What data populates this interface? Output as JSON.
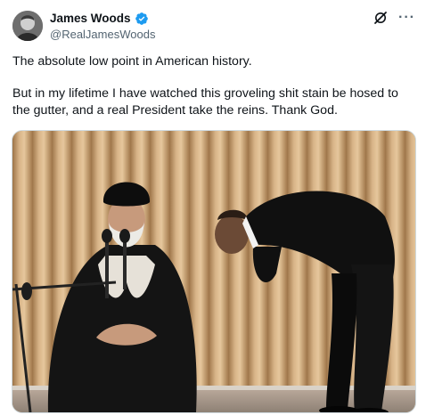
{
  "author": {
    "display_name": "James Woods",
    "handle": "@RealJamesWoods",
    "verified": true,
    "verified_color": "#1d9bf0"
  },
  "header": {
    "grok_icon": "grok-slash-icon",
    "more_icon": "more-icon",
    "more_label": "···"
  },
  "tweet": {
    "paragraphs": [
      "The absolute low point in American history.",
      "But in my lifetime I have watched this groveling shit stain be hosed to the gutter, and a real President take the reins. Thank God."
    ]
  },
  "media": {
    "type": "photo",
    "scene": "two men in front of a beige pleated curtain, one seated with a microphone, one bowing"
  }
}
